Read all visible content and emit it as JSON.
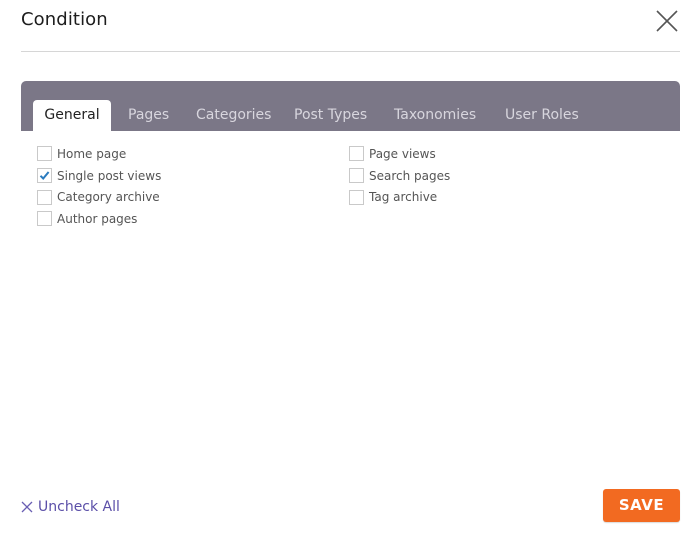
{
  "dialog": {
    "title": "Condition",
    "close_icon": "close-icon"
  },
  "tabs": [
    {
      "label": "General",
      "active": true
    },
    {
      "label": "Pages",
      "active": false
    },
    {
      "label": "Categories",
      "active": false
    },
    {
      "label": "Post Types",
      "active": false
    },
    {
      "label": "Taxonomies",
      "active": false
    },
    {
      "label": "User Roles",
      "active": false
    }
  ],
  "options": {
    "left": [
      {
        "label": "Home page",
        "checked": false
      },
      {
        "label": "Single post views",
        "checked": true
      },
      {
        "label": "Category archive",
        "checked": false
      },
      {
        "label": "Author pages",
        "checked": false
      }
    ],
    "right": [
      {
        "label": "Page views",
        "checked": false
      },
      {
        "label": "Search pages",
        "checked": false
      },
      {
        "label": "Tag archive",
        "checked": false
      }
    ]
  },
  "footer": {
    "uncheck_all_label": "Uncheck All",
    "save_label": "SAVE"
  },
  "colors": {
    "tabbar": "#7b7787",
    "accent": "#f26a21",
    "link": "#5b4fa8",
    "check": "#2a7bbf"
  }
}
